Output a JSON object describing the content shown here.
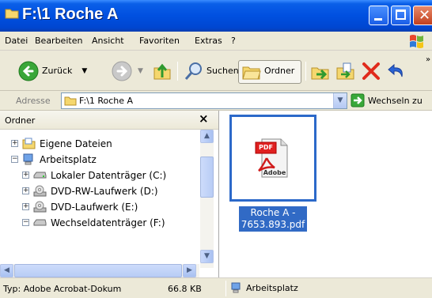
{
  "window": {
    "title": "F:\\1 Roche A"
  },
  "menu": [
    "Datei",
    "Bearbeiten",
    "Ansicht",
    "Favoriten",
    "Extras",
    "?"
  ],
  "toolbar": {
    "back_label": "Zurück",
    "search_label": "Suchen",
    "folders_label": "Ordner"
  },
  "address": {
    "label": "Adresse",
    "value": "F:\\1 Roche A",
    "go_label": "Wechseln zu"
  },
  "folder_pane": {
    "title": "Ordner",
    "close_glyph": "×",
    "items": [
      {
        "label": "Eigene Dateien",
        "expander": "+",
        "icon": "my-documents-icon"
      },
      {
        "label": "Arbeitsplatz",
        "expander": "−",
        "icon": "my-computer-icon"
      },
      {
        "label": "Lokaler Datenträger (C:)",
        "expander": "+",
        "icon": "hard-drive-icon"
      },
      {
        "label": "DVD-RW-Laufwerk (D:)",
        "expander": "+",
        "icon": "dvd-drive-icon"
      },
      {
        "label": "DVD-Laufwerk (E:)",
        "expander": "+",
        "icon": "dvd-drive-icon"
      },
      {
        "label": "Wechseldatenträger (F:)",
        "expander": "−",
        "icon": "removable-drive-icon"
      }
    ]
  },
  "files": [
    {
      "name_line1": "Roche A -",
      "name_line2": "7653.893.pdf",
      "pdf_badge": "PDF",
      "adobe_text": "Adobe"
    }
  ],
  "status": {
    "type_text": "Typ: Adobe Acrobat-Dokum",
    "size_text": "66.8 KB",
    "location_text": "Arbeitsplatz"
  },
  "colors": {
    "titlebar": "#0050e0",
    "selection": "#316ac5",
    "chrome": "#ece9d8"
  }
}
